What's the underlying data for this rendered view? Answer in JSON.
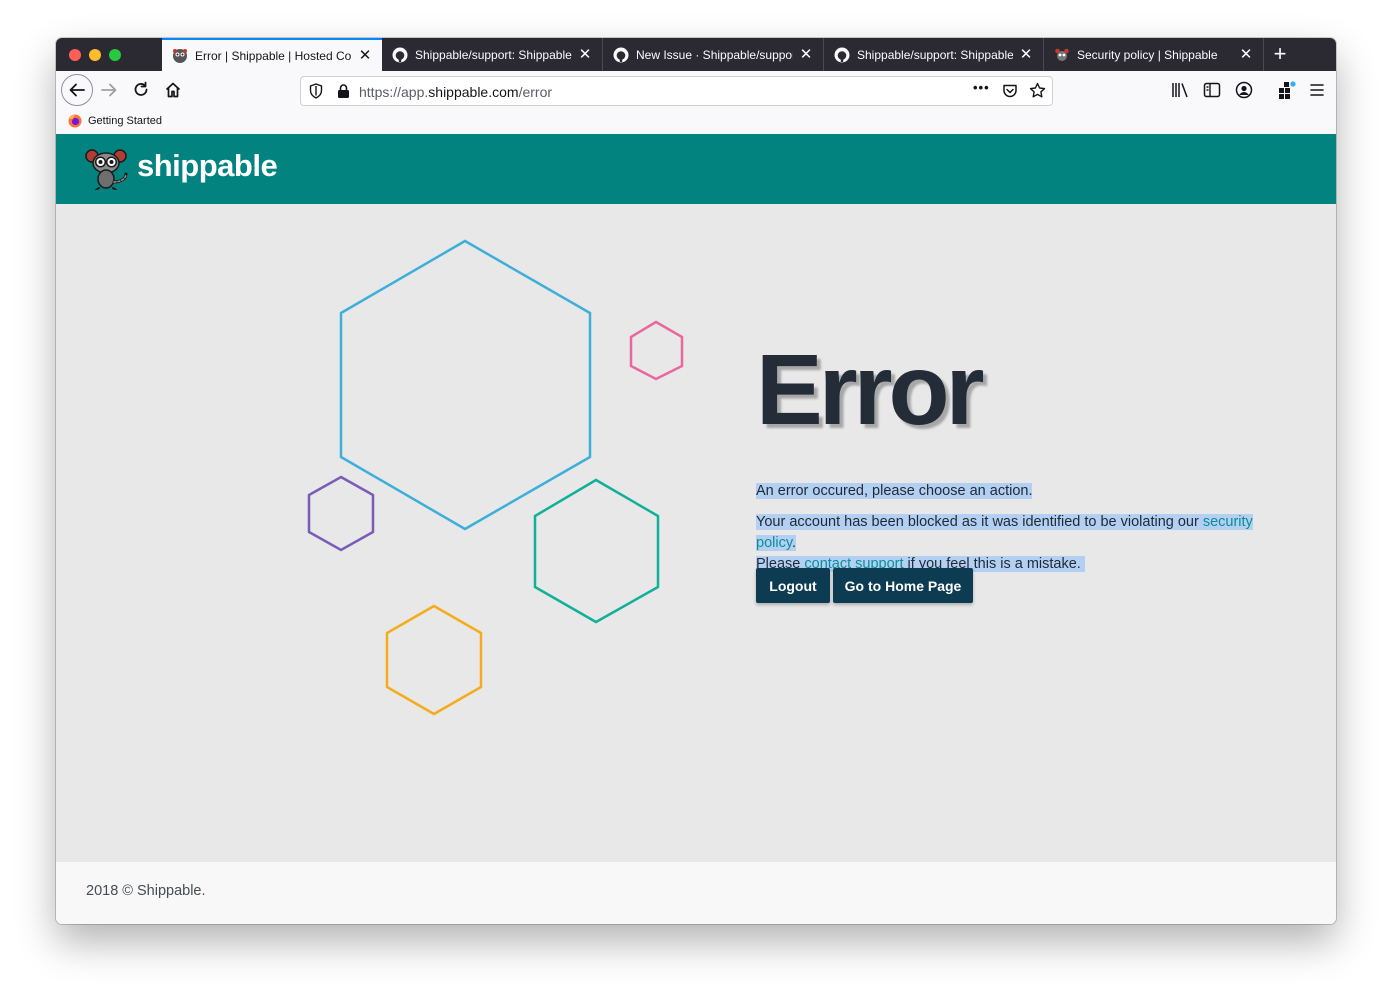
{
  "browser": {
    "tabs": [
      {
        "label": "Error | Shippable | Hosted Con",
        "active": true,
        "favicon": "shippable-favicon"
      },
      {
        "label": "Shippable/support: Shippable",
        "active": false,
        "favicon": "github-icon"
      },
      {
        "label": "New Issue · Shippable/support",
        "active": false,
        "favicon": "github-icon"
      },
      {
        "label": "Shippable/support: Shippable",
        "active": false,
        "favicon": "github-icon"
      },
      {
        "label": "Security policy | Shippable",
        "active": false,
        "favicon": "shippable-favicon"
      }
    ],
    "url_prefix": "https://app.",
    "url_host": "shippable.com",
    "url_path": "/error",
    "url_menu": "•••",
    "bookmark": "Getting Started"
  },
  "site": {
    "brand": "shippable",
    "header_color": "#028380"
  },
  "error": {
    "title": "Error",
    "line1": "An error occured, please choose an action.",
    "line2_before": "Your account has been blocked as it was identified to be violating our ",
    "line2_link": "security policy",
    "line2_after": ".",
    "line3_before": "Please ",
    "line3_link": "contact support",
    "line3_after": " if you feel this is a mistake."
  },
  "actions": {
    "logout": "Logout",
    "home": "Go to Home Page"
  },
  "footer": {
    "text": "2018 © Shippable."
  },
  "hex_colors": [
    "#3eaedb",
    "#e8689b",
    "#7a5bb8",
    "#12b09a",
    "#f5ac1c"
  ]
}
